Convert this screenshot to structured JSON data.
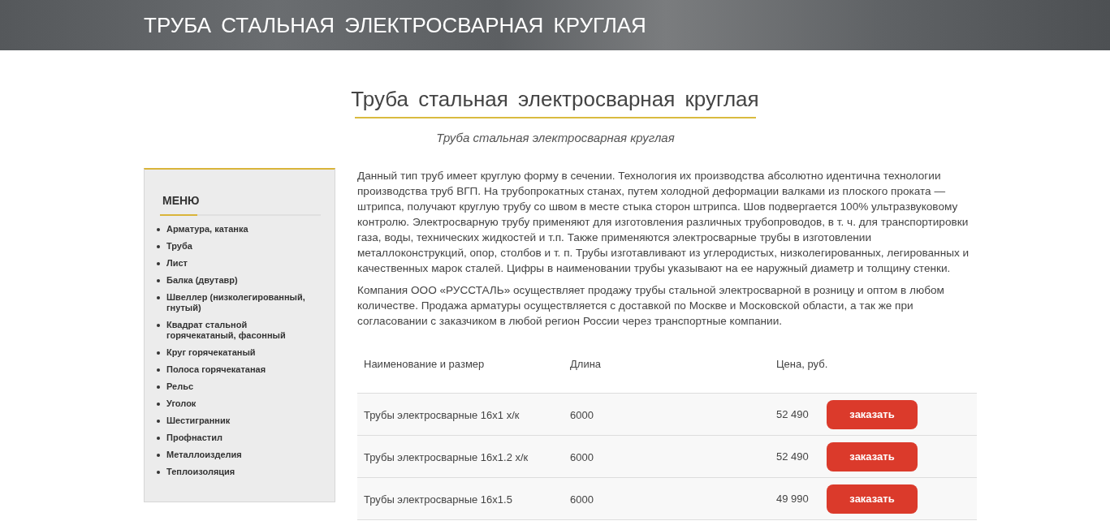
{
  "header": {
    "title": "ТРУБА СТАЛЬНАЯ ЭЛЕКТРОСВАРНАЯ КРУГЛАЯ"
  },
  "page": {
    "heading": "Труба стальная электросварная круглая",
    "subtitle": "Труба стальная электросварная круглая"
  },
  "sidebar": {
    "title": "МЕНЮ",
    "items": [
      "Арматура, катанка",
      "Труба",
      "Лист",
      "Балка (двутавр)",
      "Швеллер (низколегированный, гнутый)",
      "Квадрат стальной горячекатаный, фасонный",
      "Круг горячекатаный",
      "Полоса горячекатаная",
      "Рельс",
      "Уголок",
      "Шестигранник",
      "Профнастил",
      "Металлоизделия",
      "Теплоизоляция"
    ]
  },
  "content": {
    "paragraphs": [
      "Данный тип труб имеет круглую форму в сечении. Технология их производства абсолютно идентична технологии производства труб ВГП. На трубопрокатных станах, путем холодной деформации валками из плоского проката — штрипса, получают круглую трубу со швом в месте стыка сторон штрипса. Шов подвергается 100% ультразвуковому контролю. Электросварную трубу применяют для изготовления различных трубопроводов, в т. ч. для транспортировки газа, воды, технических жидкостей и т.п. Также применяются электросварные трубы в изготовлении металлоконструкций, опор, столбов и т. п. Трубы изготавливают из углеродистых, низколегированных, легированных и качественных марок сталей. Цифры в наименовании трубы указывают на ее наружный диаметр и толщину стенки.",
      "Компания ООО «РУССТАЛЬ» осуществляет продажу трубы стальной электросварной в розницу и оптом в любом количестве. Продажа арматуры осуществляется с доставкой по Москве и Московской области, а так же при согласовании с заказчиком в любой регион России через транспортные компании."
    ]
  },
  "table": {
    "columns": [
      "Наименование и размер",
      "Длина",
      "Цена, руб."
    ],
    "rows": [
      {
        "name": "Трубы электросварные 16x1 х/к",
        "length": "6000",
        "price": "52 490",
        "action": "заказать"
      },
      {
        "name": "Трубы электросварные 16x1.2 х/к",
        "length": "6000",
        "price": "52 490",
        "action": "заказать"
      },
      {
        "name": "Трубы электросварные 16x1.5",
        "length": "6000",
        "price": "49 990",
        "action": "заказать"
      }
    ]
  }
}
